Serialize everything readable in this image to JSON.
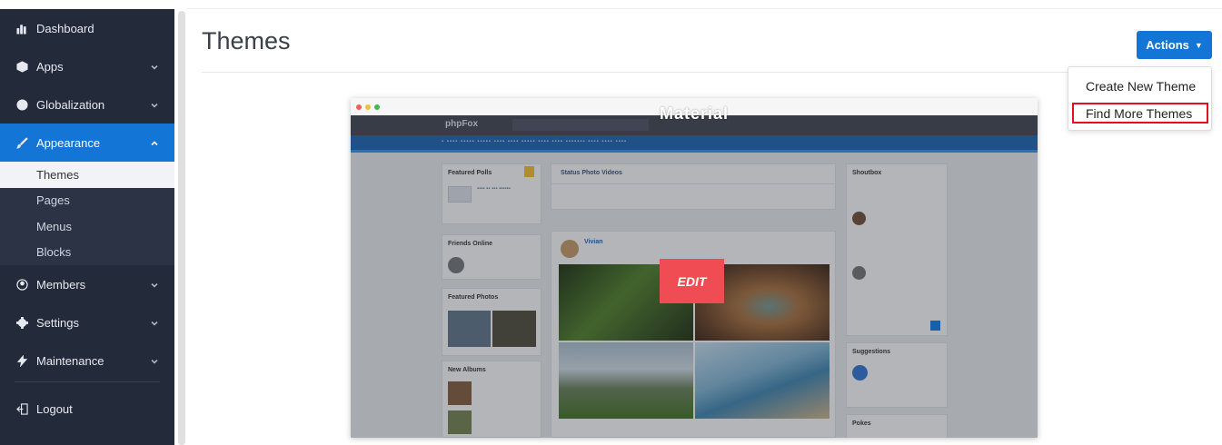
{
  "sidebar": {
    "items": [
      {
        "label": "Dashboard",
        "icon": "bar-chart-icon"
      },
      {
        "label": "Apps",
        "icon": "cube-icon"
      },
      {
        "label": "Globalization",
        "icon": "globe-icon"
      },
      {
        "label": "Appearance",
        "icon": "brush-icon"
      },
      {
        "label": "Members",
        "icon": "user-circle-icon"
      },
      {
        "label": "Settings",
        "icon": "gear-icon"
      },
      {
        "label": "Maintenance",
        "icon": "bolt-icon"
      },
      {
        "label": "Logout",
        "icon": "logout-icon"
      }
    ],
    "appearance_sub": [
      "Themes",
      "Pages",
      "Menus",
      "Blocks"
    ]
  },
  "main": {
    "title": "Themes",
    "actions_label": "Actions",
    "dropdown": [
      "Create New Theme",
      "Find More Themes"
    ]
  },
  "theme_card": {
    "name": "Material",
    "edit_label": "EDIT",
    "preview": {
      "logo": "phpFox",
      "panels": {
        "featured_polls": "Featured Polls",
        "friends_online": "Friends Online",
        "featured_photos": "Featured Photos",
        "new_albums": "New Albums",
        "shoutbox": "Shoutbox",
        "suggestions": "Suggestions",
        "pokes": "Pokes"
      },
      "status_tabs": "Status   Photo   Videos",
      "poster": "Vivian"
    }
  },
  "colors": {
    "sidebar_bg": "#232b3a",
    "accent": "#1376d6",
    "highlight_box": "#e3101a",
    "edit_button": "#ef4d53"
  }
}
